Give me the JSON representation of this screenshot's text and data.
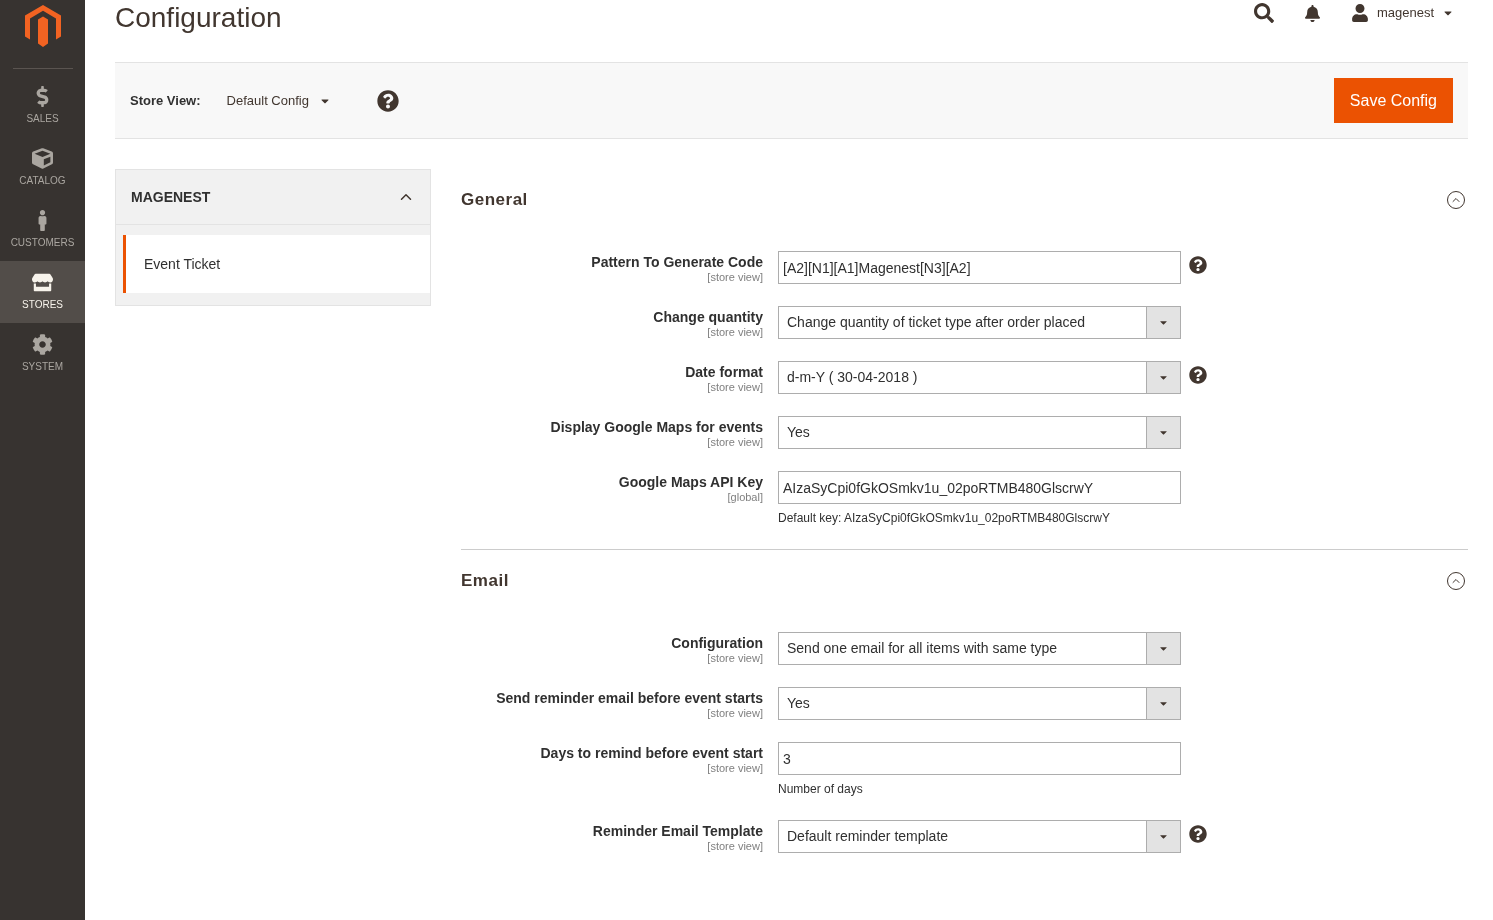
{
  "nav": [
    {
      "label": "SALES",
      "selected": false
    },
    {
      "label": "CATALOG",
      "selected": false
    },
    {
      "label": "CUSTOMERS",
      "selected": false
    },
    {
      "label": "STORES",
      "selected": true
    },
    {
      "label": "SYSTEM",
      "selected": false
    }
  ],
  "title": "Configuration",
  "user": "magenest",
  "store_view": {
    "label": "Store View:",
    "value": "Default Config"
  },
  "save_button": "Save Config",
  "tabs": {
    "title": "MAGENEST",
    "expanded": true,
    "items": [
      {
        "label": "Event Ticket",
        "selected": true
      }
    ]
  },
  "sections": [
    {
      "title": "General",
      "expanded": true,
      "fields": [
        {
          "label": "Pattern To Generate Code",
          "scope": "[store view]",
          "kind": "text",
          "value": "[A2][N1][A1]Magenest[N3][A2]",
          "help": true
        },
        {
          "label": "Change quantity",
          "scope": "[store view]",
          "kind": "select",
          "value": "Change quantity of ticket type after order placed",
          "help": false
        },
        {
          "label": "Date format",
          "scope": "[store view]",
          "kind": "select",
          "value": "d-m-Y ( 30-04-2018 )",
          "help": true
        },
        {
          "label": "Display Google Maps for events",
          "scope": "[store view]",
          "kind": "select",
          "value": "Yes",
          "help": false
        },
        {
          "label": "Google Maps API Key",
          "scope": "[global]",
          "kind": "text",
          "value": "AIzaSyCpi0fGkOSmkv1u_02poRTMB480GlscrwY",
          "help": false,
          "note": "Default key: AIzaSyCpi0fGkOSmkv1u_02poRTMB480GlscrwY"
        }
      ]
    },
    {
      "title": "Email",
      "expanded": true,
      "fields": [
        {
          "label": "Configuration",
          "scope": "[store view]",
          "kind": "select",
          "value": "Send one email for all items with same type",
          "help": false
        },
        {
          "label": "Send reminder email before event starts",
          "scope": "[store view]",
          "kind": "select",
          "value": "Yes",
          "help": false
        },
        {
          "label": "Days to remind before event start",
          "scope": "[store view]",
          "kind": "text",
          "value": "3",
          "help": false,
          "note": "Number of days"
        },
        {
          "label": "Reminder Email Template",
          "scope": "[store view]",
          "kind": "select",
          "value": "Default reminder template",
          "help": true
        }
      ]
    }
  ]
}
